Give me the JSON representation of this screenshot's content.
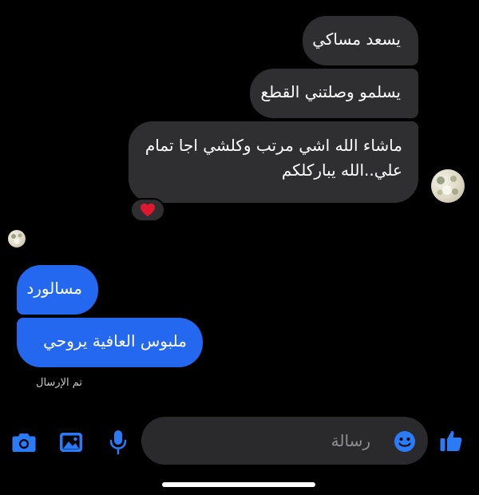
{
  "conversation": {
    "incoming": [
      {
        "text": "يسعد مساكي"
      },
      {
        "text": "يسلمو وصلتني القطع"
      },
      {
        "line1": "ماشاء الله اشي مرتب وكلشي اجا تمام",
        "line2": "علي..الله يباركلكم"
      }
    ],
    "reaction": {
      "icon": "heart-icon",
      "color": "#e0182d"
    },
    "outgoing": [
      {
        "text": "مسالورد"
      },
      {
        "text": "ملبوس العافية يروحي"
      }
    ],
    "status": "تم الإرسال"
  },
  "composer": {
    "placeholder": "رسالة",
    "icons": [
      "camera-icon",
      "image-icon",
      "microphone-icon",
      "emoji-icon",
      "thumbs-up-icon"
    ]
  },
  "colors": {
    "background": "#000000",
    "incoming_bubble": "#2f2f31",
    "outgoing_bubble": "#2368ee",
    "accent": "#2a7bf6"
  }
}
